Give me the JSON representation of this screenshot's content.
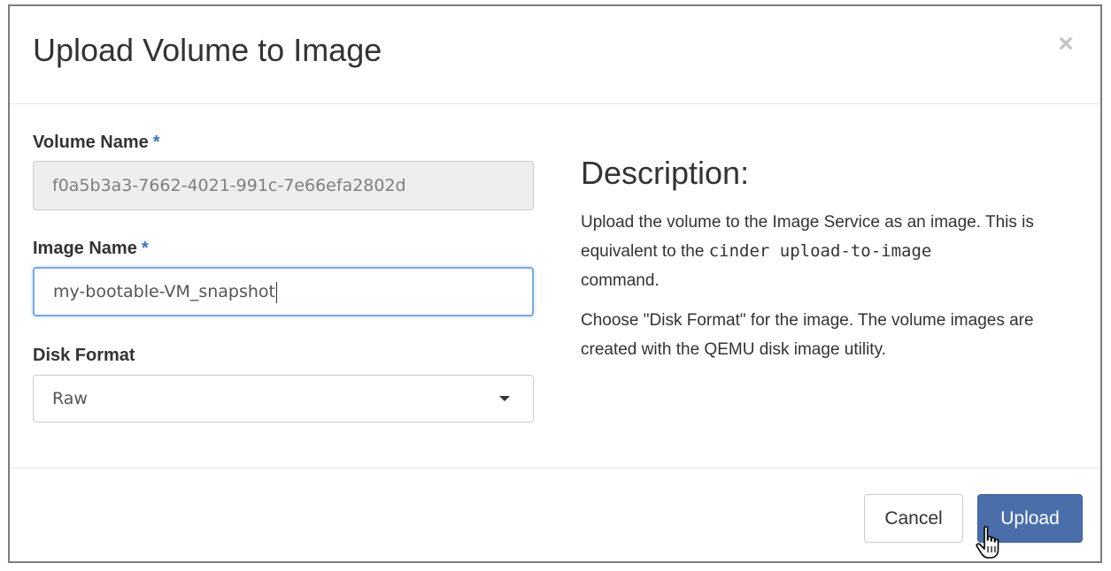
{
  "modal": {
    "title": "Upload Volume to Image",
    "close_label": "×"
  },
  "form": {
    "volume_name": {
      "label": "Volume Name",
      "required_mark": "*",
      "value": "f0a5b3a3-7662-4021-991c-7e66efa2802d"
    },
    "image_name": {
      "label": "Image Name",
      "required_mark": "*",
      "value": "my-bootable-VM_snapshot"
    },
    "disk_format": {
      "label": "Disk Format",
      "selected": "Raw"
    }
  },
  "description": {
    "title": "Description:",
    "p1_text": "Upload the volume to the Image Service as an image. This is equivalent to the ",
    "p1_code": "cinder upload-to-image",
    "p1_end": "command.",
    "p2": "Choose \"Disk Format\" for the image. The volume images are created with the QEMU disk image utility."
  },
  "footer": {
    "cancel_label": "Cancel",
    "upload_label": "Upload"
  },
  "icons": {
    "close": "close-icon",
    "select_arrow": "caret-down-icon",
    "cursor": "hand-pointer-icon"
  },
  "colors": {
    "primary": "#4a6ea9",
    "required": "#3a76b6",
    "focus_border": "#7fa8dc"
  }
}
